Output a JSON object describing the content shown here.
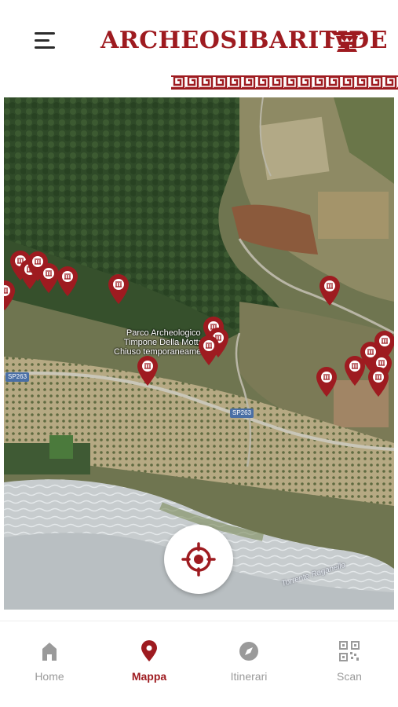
{
  "header": {
    "title": "ARCHEOSIBARITIDE",
    "menu_icon": "hamburger-menu-icon",
    "logo_icon": "greek-vase-logo-icon"
  },
  "map": {
    "place_label_line1": "Parco Archeologico",
    "place_label_line2": "Timpone Della Motta",
    "place_status": "Chiuso temporaneamente",
    "road_label_1": "SP263",
    "road_label_2": "SP263",
    "river_label": "Torrente Raganello",
    "marker_color": "#9e1b20",
    "marker_icon": "temple-column-icon",
    "locate_icon": "crosshair-target-icon"
  },
  "nav": {
    "items": [
      {
        "label": "Home",
        "icon": "home-icon",
        "active": false
      },
      {
        "label": "Mappa",
        "icon": "map-pin-icon",
        "active": true
      },
      {
        "label": "Itinerari",
        "icon": "compass-icon",
        "active": false
      },
      {
        "label": "Scan",
        "icon": "qr-code-icon",
        "active": false
      }
    ]
  },
  "colors": {
    "accent": "#9e1b20",
    "inactive": "#9a9a9a"
  }
}
